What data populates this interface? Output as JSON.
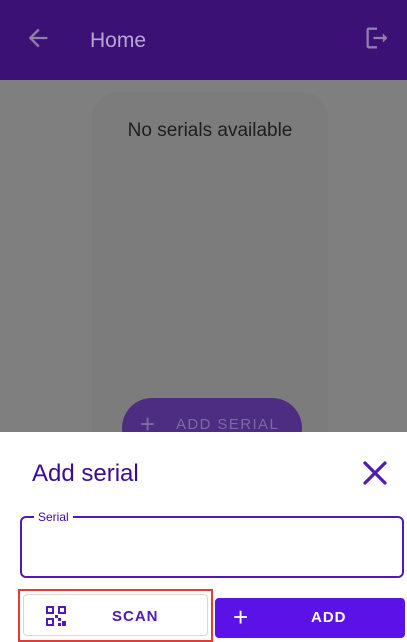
{
  "app_bar": {
    "title": "Home",
    "back_icon": "arrow-left-icon",
    "logout_icon": "logout-icon"
  },
  "content": {
    "empty_message": "No serials available",
    "fab": {
      "icon": "plus-icon",
      "plus": "+",
      "label": "ADD SERIAL"
    }
  },
  "sheet": {
    "title": "Add serial",
    "close_icon": "close-icon",
    "serial_field": {
      "label": "Serial",
      "value": ""
    },
    "scan_button": {
      "icon": "qr-code-icon",
      "label": "SCAN"
    },
    "add_button": {
      "icon": "plus-icon",
      "plus": "+",
      "label": "ADD"
    }
  },
  "colors": {
    "app_bar": "#3b1175",
    "primary": "#5b12e6",
    "heading": "#3d0b93",
    "overlay": "#7f7f7f",
    "highlight": "#e33a3a"
  }
}
